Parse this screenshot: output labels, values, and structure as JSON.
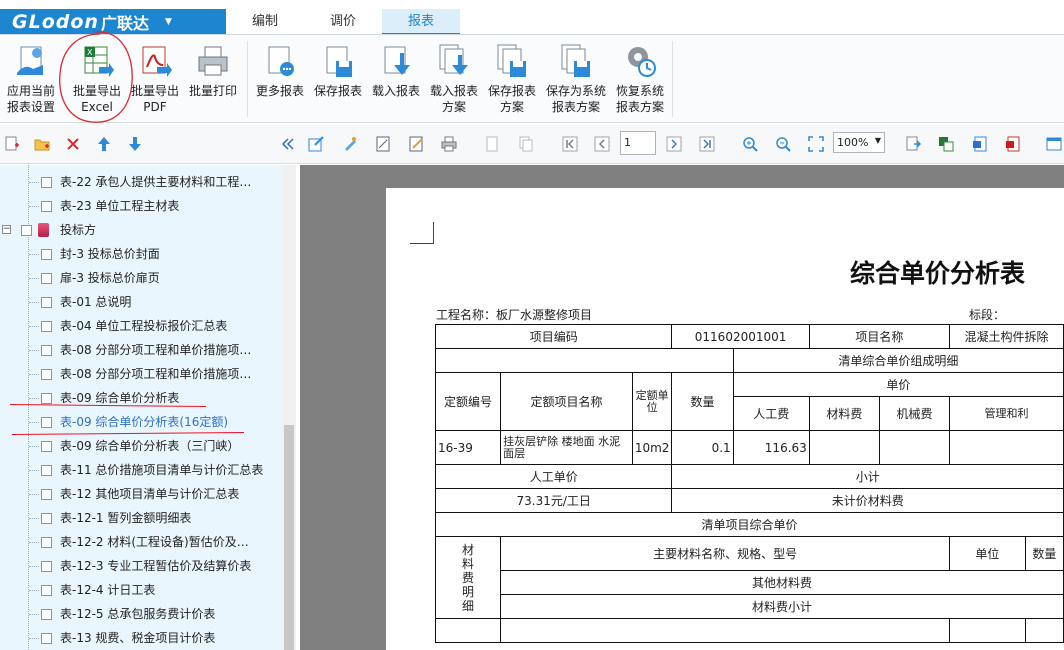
{
  "app": {
    "brand": "GLodon",
    "brand_cn": "广联达",
    "tabs": [
      {
        "label": "编制",
        "active": false
      },
      {
        "label": "调价",
        "active": false
      },
      {
        "label": "报表",
        "active": true
      }
    ]
  },
  "ribbon": {
    "buttons": [
      {
        "line1": "应用当前",
        "line2": "报表设置",
        "icon": "apply-settings-icon"
      },
      {
        "line1": "批量导出",
        "line2": "Excel",
        "icon": "excel-export-icon"
      },
      {
        "line1": "批量导出",
        "line2": "PDF",
        "icon": "pdf-export-icon"
      },
      {
        "line1": "批量打印",
        "line2": "",
        "icon": "printer-icon"
      },
      {
        "line1": "更多报表",
        "line2": "",
        "icon": "more-reports-icon"
      },
      {
        "line1": "保存报表",
        "line2": "",
        "icon": "save-report-icon"
      },
      {
        "line1": "载入报表",
        "line2": "",
        "icon": "load-report-icon"
      },
      {
        "line1": "载入报表",
        "line2": "方案",
        "icon": "load-scheme-icon"
      },
      {
        "line1": "保存报表",
        "line2": "方案",
        "icon": "save-scheme-icon"
      },
      {
        "line1": "保存为系统",
        "line2": "报表方案",
        "icon": "save-system-scheme-icon"
      },
      {
        "line1": "恢复系统",
        "line2": "报表方案",
        "icon": "restore-system-icon"
      }
    ]
  },
  "toolbar2": {
    "page_value": "1",
    "zoom_value": "100%"
  },
  "tree": {
    "items": [
      {
        "label": "表-22 承包人提供主要材料和工程…",
        "type": "item"
      },
      {
        "label": "表-23 单位工程主材表",
        "type": "item"
      },
      {
        "label": "投标方",
        "type": "folder"
      },
      {
        "label": "封-3 投标总价封面",
        "type": "item"
      },
      {
        "label": "扉-3 投标总价扉页",
        "type": "item"
      },
      {
        "label": "表-01 总说明",
        "type": "item"
      },
      {
        "label": "表-04 单位工程投标报价汇总表",
        "type": "item"
      },
      {
        "label": "表-08 分部分项工程和单价措施项…",
        "type": "item"
      },
      {
        "label": "表-08 分部分项工程和单价措施项…",
        "type": "item"
      },
      {
        "label": "表-09 综合单价分析表",
        "type": "item"
      },
      {
        "label": "表-09 综合单价分析表(16定额)",
        "type": "item",
        "selected": true
      },
      {
        "label": "表-09 综合单价分析表（三门峡）",
        "type": "item"
      },
      {
        "label": "表-11 总价措施项目清单与计价汇总表",
        "type": "item"
      },
      {
        "label": "表-12 其他项目清单与计价汇总表",
        "type": "item"
      },
      {
        "label": "表-12-1 暂列金额明细表",
        "type": "item"
      },
      {
        "label": "表-12-2 材料(工程设备)暂估价及…",
        "type": "item"
      },
      {
        "label": "表-12-3 专业工程暂估价及结算价表",
        "type": "item"
      },
      {
        "label": "表-12-4 计日工表",
        "type": "item"
      },
      {
        "label": "表-12-5 总承包服务费计价表",
        "type": "item"
      },
      {
        "label": "表-13 规费、税金项目计价表",
        "type": "item"
      }
    ]
  },
  "report": {
    "title": "综合单价分析表",
    "project_label": "工程名称：",
    "project_name": "板厂水源整修项目",
    "section_label": "标段：",
    "h_code": "项目编码",
    "code": "011602001001",
    "h_name": "项目名称",
    "name": "混凝土构件拆除",
    "composition": "清单综合单价组成明细",
    "h_quota_no": "定额编号",
    "h_quota_name": "定额项目名称",
    "h_quota_unit": "定额单位",
    "h_qty": "数量",
    "h_unit_price": "单价",
    "h_labor": "人工费",
    "h_material": "材料费",
    "h_machine": "机械费",
    "h_mgmt": "管理和利",
    "row_quota_no": "16-39",
    "row_quota_name": "挂灰层铲除 楼地面 水泥面层",
    "row_unit": "10m2",
    "row_qty": "0.1",
    "row_labor": "116.63",
    "labor_unit_label": "人工单价",
    "subtotal": "小计",
    "labor_rate": "73.31元/工日",
    "unpriced_material": "未计价材料费",
    "item_unit_price": "清单项目综合单价",
    "material_detail": "材料费明细",
    "main_material": "主要材料名称、规格、型号",
    "unit": "单位",
    "quantity": "数量",
    "other_material": "其他材料费",
    "material_subtotal": "材料费小计"
  }
}
